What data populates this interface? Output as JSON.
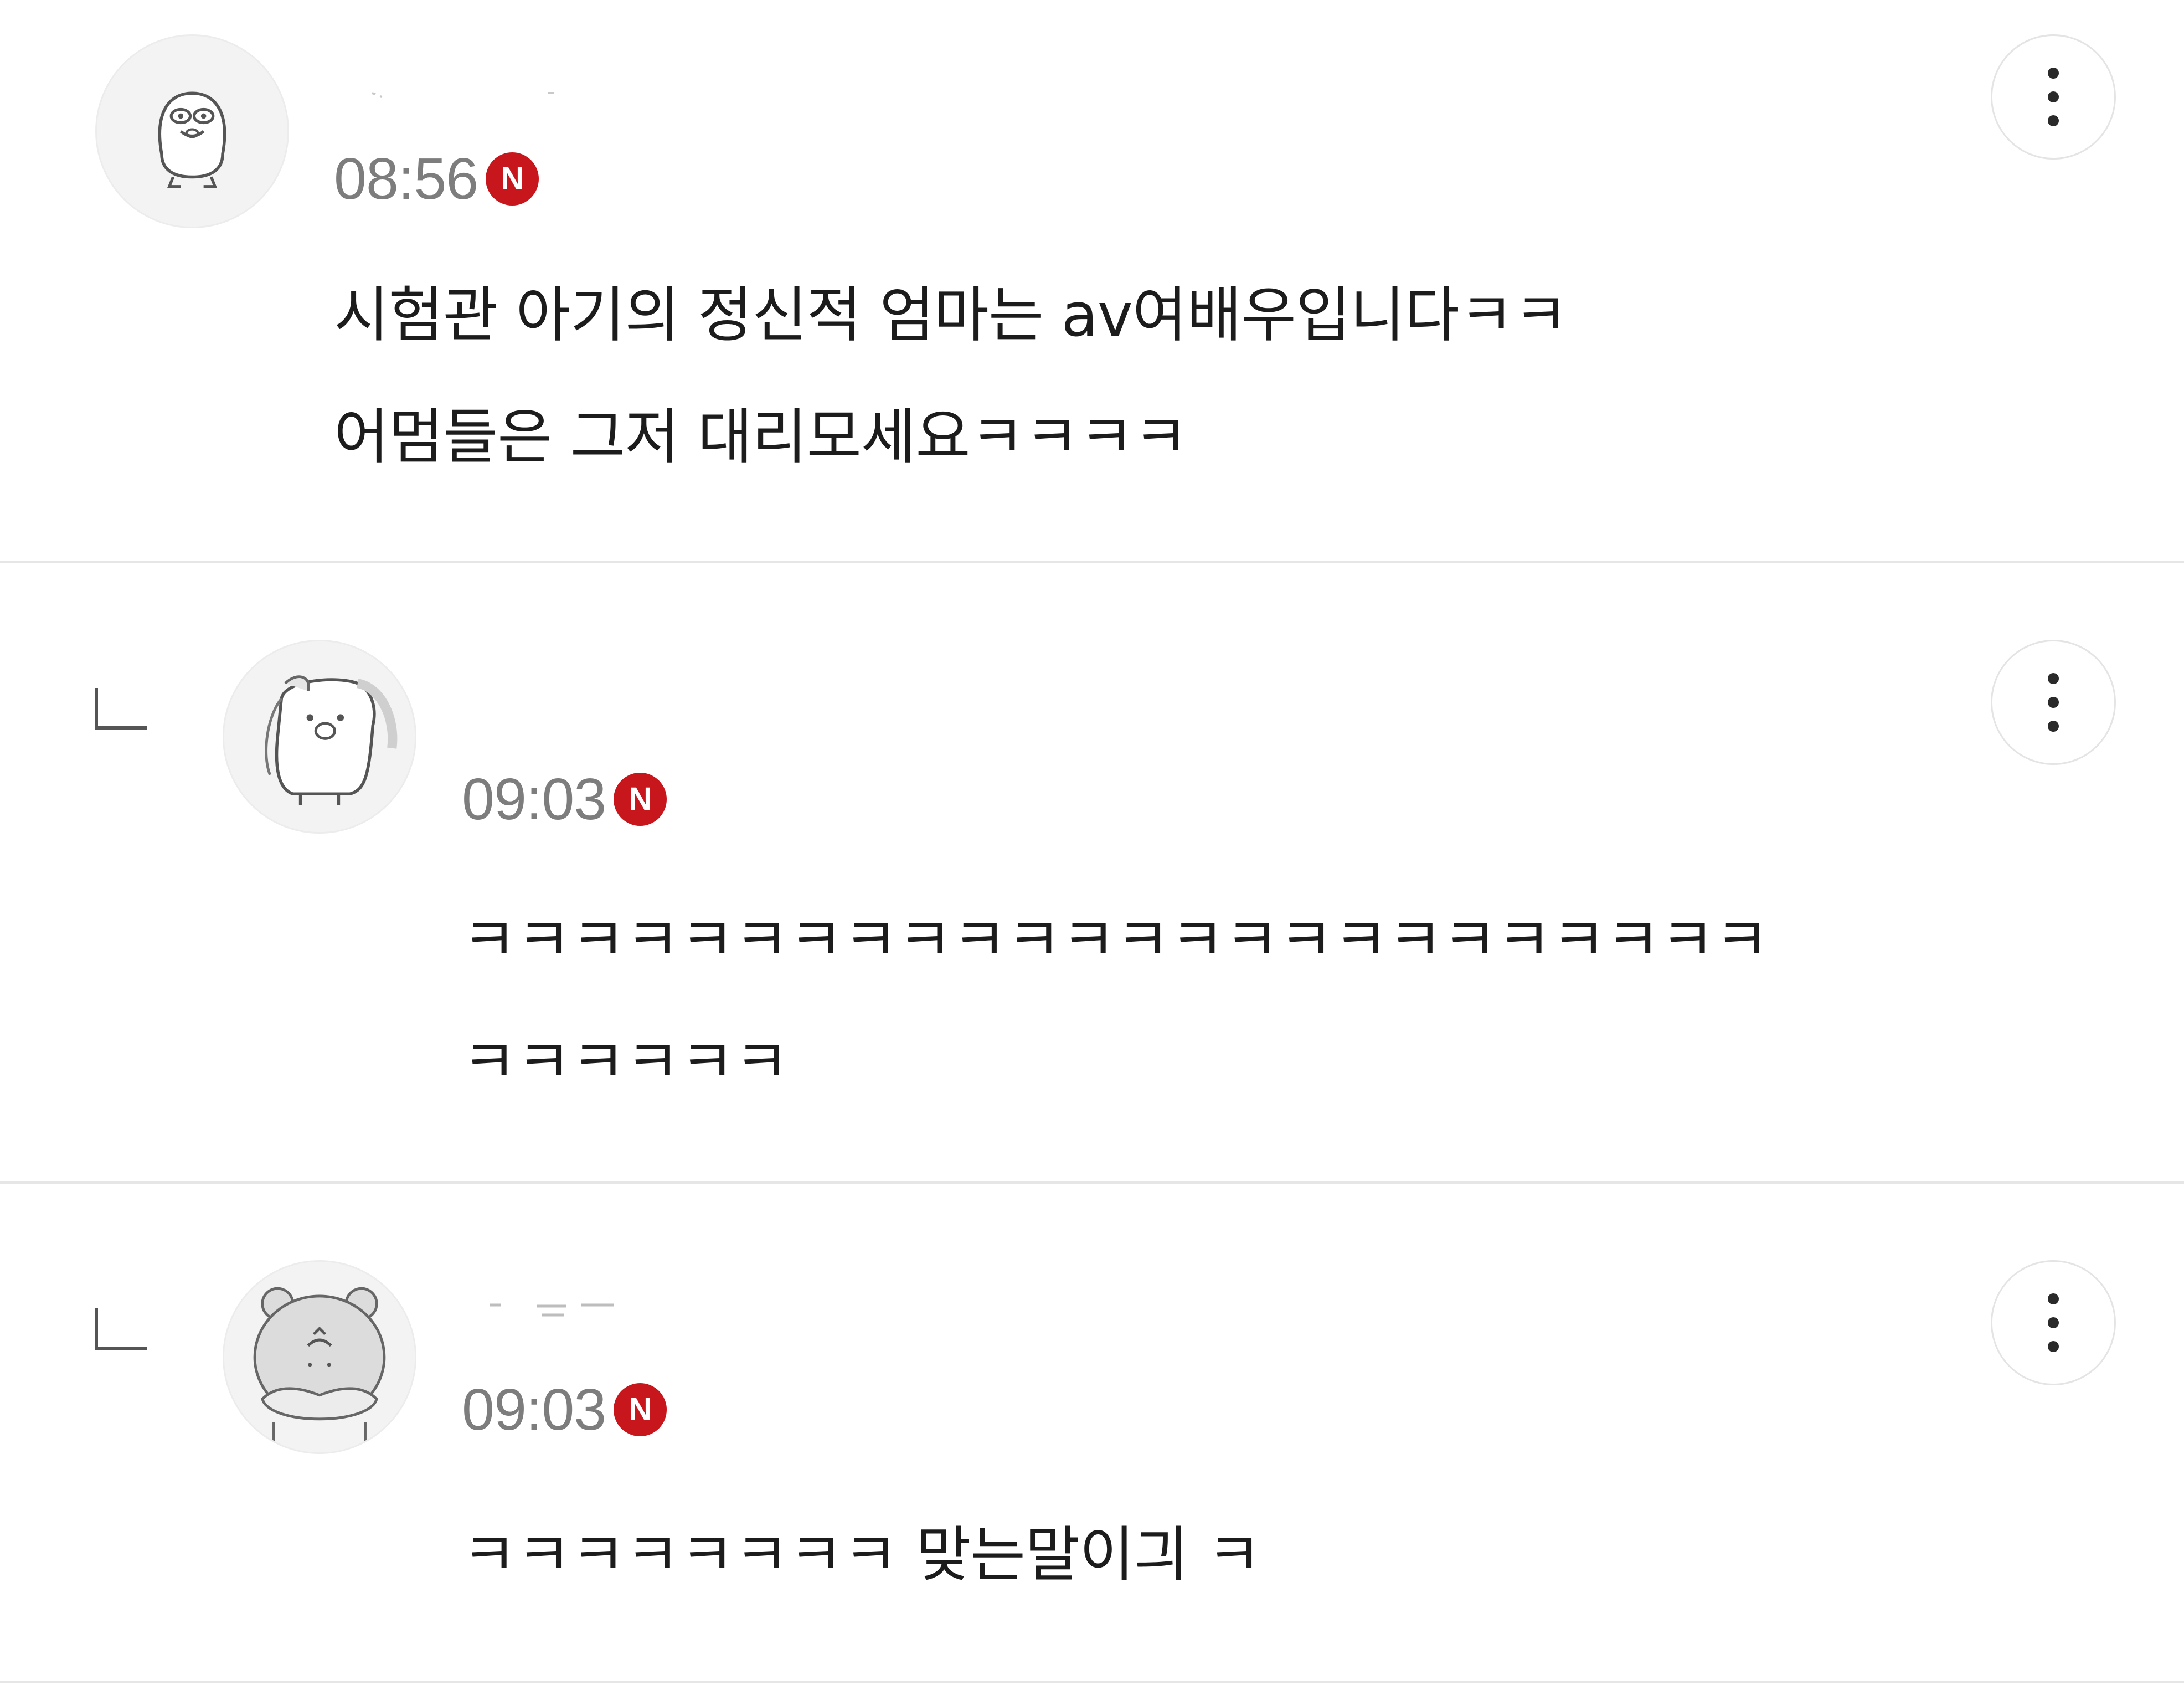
{
  "comments": [
    {
      "time": "08:56",
      "badge": "N",
      "avatar": "cat-doodle-avatar",
      "lines": [
        "시험관 아기의 정신적 엄마는 av여배우입니다ㅋㅋ",
        "어멈들은 그저 대리모세요ㅋㅋㅋㅋ"
      ]
    },
    {
      "time": "09:03",
      "badge": "N",
      "avatar": "penguin-doodle-avatar",
      "reply_icon": "reply-arrow-icon",
      "lines": [
        "ㅋㅋㅋㅋㅋㅋㅋㅋㅋㅋㅋㅋㅋㅋㅋㅋㅋㅋㅋㅋㅋㅋㅋㅋ",
        "ㅋㅋㅋㅋㅋㅋ"
      ]
    },
    {
      "time": "09:03",
      "badge": "N",
      "avatar": "bear-doodle-avatar",
      "reply_icon": "reply-arrow-icon",
      "lines": [
        "ㅋㅋㅋㅋㅋㅋㅋㅋ 맞는말이긔 ㅋ"
      ]
    }
  ],
  "icons": {
    "more": "more-vertical-icon",
    "reply": "reply-arrow-icon",
    "new": "new-badge-icon"
  },
  "colors": {
    "time": "#7d7d7d",
    "badge": "#c8161d",
    "divider": "#e6e6e6",
    "text": "#1c1c1c"
  }
}
